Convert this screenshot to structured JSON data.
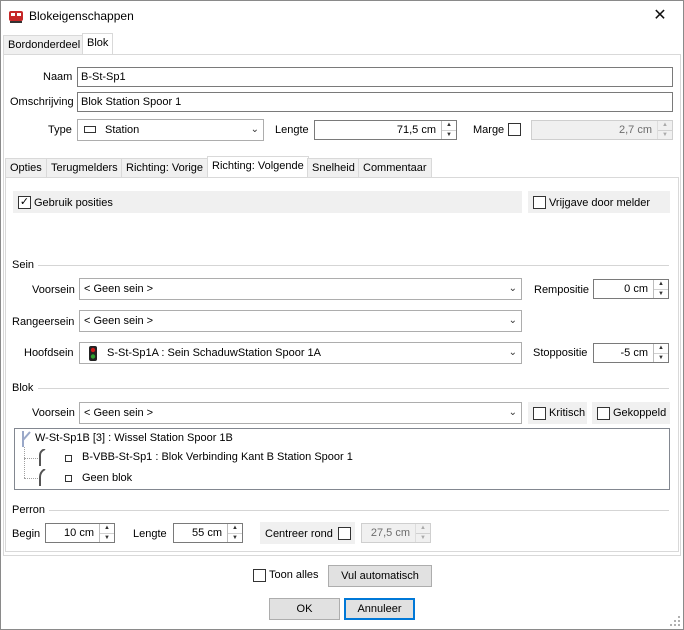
{
  "window": {
    "title": "Blokeigenschappen",
    "close_glyph": "✕"
  },
  "top_tabs": [
    "Bordonderdeel",
    "Blok"
  ],
  "form": {
    "naam_label": "Naam",
    "naam_value": "B-St-Sp1",
    "omschrijving_label": "Omschrijving",
    "omschrijving_value": "Blok Station Spoor 1",
    "type_label": "Type",
    "type_value": "Station",
    "lengte_label": "Lengte",
    "lengte_value": "71,5 cm",
    "marge_label": "Marge",
    "marge_value": "2,7 cm"
  },
  "inner_tabs": [
    "Opties",
    "Terugmelders",
    "Richting: Vorige",
    "Richting: Volgende",
    "Snelheid",
    "Commentaar"
  ],
  "options": {
    "gebruik_posities": "Gebruik posities",
    "vrijgave": "Vrijgave door melder"
  },
  "sein": {
    "group_label": "Sein",
    "voorsein_label": "Voorsein",
    "voorsein_value": "< Geen sein >",
    "rangeersein_label": "Rangeersein",
    "rangeersein_value": "< Geen sein >",
    "hoofdsein_label": "Hoofdsein",
    "hoofdsein_value": "S-St-Sp1A : Sein SchaduwStation Spoor 1A",
    "repositie_label": "Rempositie",
    "repositie_value": "0 cm",
    "stoppositie_label": "Stoppositie",
    "stoppositie_value": "-5 cm"
  },
  "blok": {
    "group_label": "Blok",
    "voorsein_label": "Voorsein",
    "voorsein_value": "< Geen sein >",
    "kritisch": "Kritisch",
    "gekoppeld": "Gekoppeld",
    "tree": [
      "W-St-Sp1B [3] : Wissel Station Spoor 1B",
      "B-VBB-St-Sp1 : Blok Verbinding Kant B Station Spoor 1",
      "Geen blok"
    ]
  },
  "perron": {
    "group_label": "Perron",
    "begin_label": "Begin",
    "begin_value": "10 cm",
    "lengte_label": "Lengte",
    "lengte_value": "55 cm",
    "centreer_label": "Centreer rond",
    "centreer_value": "27,5 cm"
  },
  "bottom": {
    "toon_alles": "Toon alles",
    "vul_automatisch": "Vul automatisch",
    "ok": "OK",
    "annuleer": "Annuleer"
  },
  "colors": {
    "accent": "#0078d7",
    "signal_red": "#d01a1a",
    "signal_green": "#2ea02e"
  }
}
